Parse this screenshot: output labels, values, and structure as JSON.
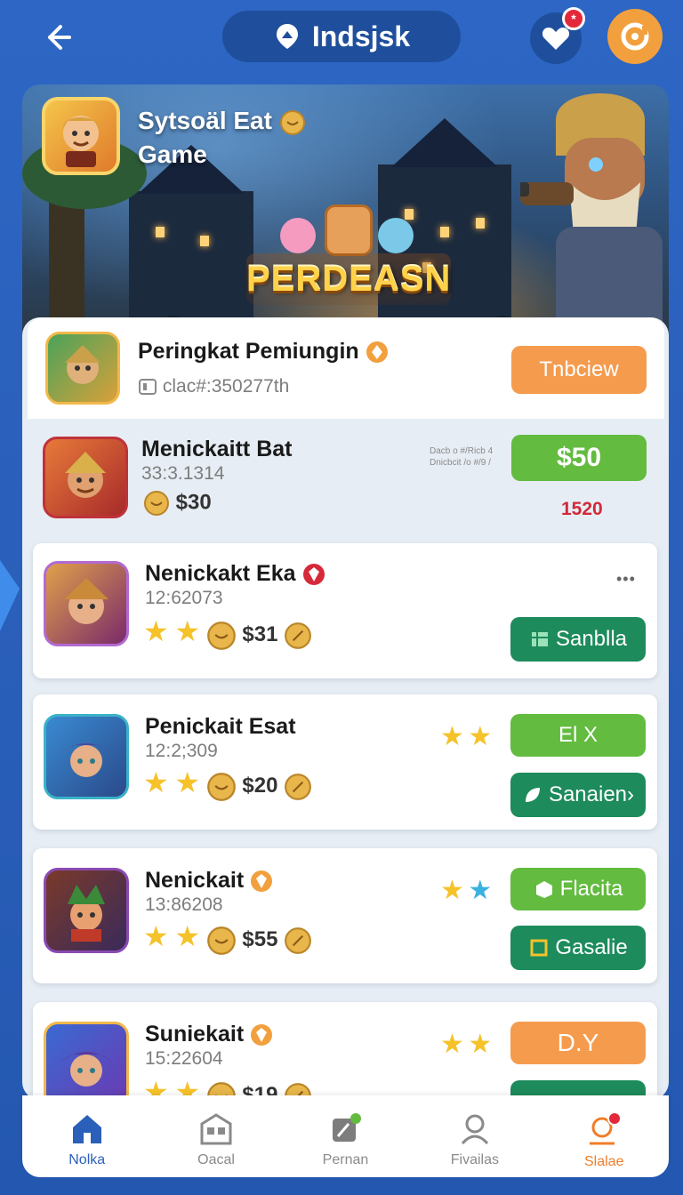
{
  "header": {
    "title": "Indsjsk",
    "heart_badge": "*"
  },
  "hero": {
    "title_line1": "Sytsoäl Eat",
    "title_line2": "Game",
    "logo_text": "PERDEASN"
  },
  "featured": {
    "name": "Peringkat Pemiungin",
    "id": "clac#:350277th",
    "button": "Tnbciew"
  },
  "rank": {
    "name": "Menickaitt Bat",
    "code": "33:3.1314",
    "price": "$30",
    "note_line1": "Dacb o #/Ricb 4",
    "note_line2": "Dnicbcit /o #/9 /",
    "button": "$50",
    "count": "1520"
  },
  "cards": [
    {
      "name": "Nenickakt Eka",
      "code": "12:62073",
      "price": "$31",
      "button": "Sanblla",
      "menu": "•••"
    },
    {
      "name": "Penickait Esat",
      "code": "12:2;309",
      "price": "$20",
      "button_top": "El X",
      "button": "Sanaien›"
    },
    {
      "name": "Nenickait",
      "code": "13:86208",
      "price": "$55",
      "button_top": "Flacita",
      "button": "Gasalie"
    },
    {
      "name": "Suniekait",
      "code": "15:22604",
      "price": "$19",
      "button_top": "D.Y",
      "button": ""
    }
  ],
  "nav": [
    {
      "label": "Nolka",
      "icon": "home-icon"
    },
    {
      "label": "Oacal",
      "icon": "building-icon"
    },
    {
      "label": "Pernan",
      "icon": "document-icon"
    },
    {
      "label": "Fivailas",
      "icon": "user-icon"
    },
    {
      "label": "Slalae",
      "icon": "notification-icon"
    }
  ],
  "colors": {
    "background": "#2a5fba",
    "orange": "#f59b4d",
    "green": "#63bb3f",
    "teal": "#1d8b5c"
  }
}
